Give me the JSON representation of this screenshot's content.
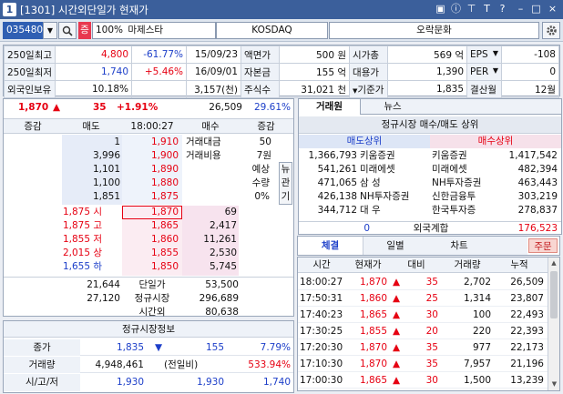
{
  "window": {
    "title": "[1301] 시간외단일가 현재가",
    "number_badge": "1",
    "controls": [
      "▣",
      "ⓘ",
      "⊤",
      "T",
      "?",
      "–",
      "□",
      "×"
    ]
  },
  "toolbar": {
    "code": "035480",
    "code_icon": "search-icon",
    "tag": "증",
    "margin": "100%",
    "name": "마제스타",
    "market": "KOSDAQ",
    "industry": "오락문화",
    "settings_icon": "gear-icon"
  },
  "info": {
    "rows": [
      [
        "250일최고",
        "4,800",
        "-61.77%",
        "15/09/23",
        "액면가",
        "500 원",
        "시가총",
        "569 억",
        "EPS",
        "-108"
      ],
      [
        "250일최저",
        "1,740",
        "+5.46%",
        "16/09/01",
        "자본금",
        "155 억",
        "대용가",
        "1,390",
        "PER",
        "0"
      ],
      [
        "외국인보유",
        "10.18%",
        "",
        "3,157(천)",
        "주식수",
        "31,021 천",
        "기준가",
        "1,835",
        "결산월",
        "12월"
      ]
    ]
  },
  "quote": {
    "price": "1,870",
    "arrow": "▲",
    "change": "35",
    "rate": "+1.91%",
    "volume": "26,509",
    "vol_rate": "29.61%"
  },
  "orderbook": {
    "headers": [
      "증감",
      "매도",
      "18:00:27",
      "매수",
      "증감"
    ],
    "asks": [
      {
        "chg": "",
        "qty": "1",
        "price": "1,910"
      },
      {
        "chg": "",
        "qty": "3,996",
        "price": "1,900"
      },
      {
        "chg": "",
        "qty": "1,101",
        "price": "1,890"
      },
      {
        "chg": "",
        "qty": "1,100",
        "price": "1,880"
      },
      {
        "chg": "",
        "qty": "1,851",
        "price": "1,875"
      }
    ],
    "ask_side_info": [
      [
        "거래대금",
        "50"
      ],
      [
        "거래비용",
        "7원"
      ]
    ],
    "expect": {
      "label1": "예상",
      "label2": "수량",
      "value": "0%",
      "tags": [
        "뉴",
        "관",
        "기"
      ]
    },
    "bids": [
      {
        "lbl": "1,875 시",
        "price": "1,870",
        "qty": "69"
      },
      {
        "lbl": "1,875 고",
        "price": "1,865",
        "qty": "2,417"
      },
      {
        "lbl": "1,855 저",
        "price": "1,860",
        "qty": "11,261"
      },
      {
        "lbl": "2,015 상",
        "price": "1,855",
        "qty": "2,530"
      },
      {
        "lbl": "1,655 하",
        "price": "1,850",
        "qty": "5,745"
      }
    ],
    "totals": [
      {
        "ask": "21,644",
        "label": "단일가",
        "bid": "53,500"
      },
      {
        "ask": "27,120",
        "label": "정규시장",
        "bid": "296,689"
      },
      {
        "ask": "",
        "label": "시간외",
        "bid": "80,638"
      }
    ]
  },
  "market_info": {
    "title": "정규시장정보",
    "rows": [
      [
        "종가",
        "1,835",
        "▼",
        "155",
        "7.79%"
      ],
      [
        "거래량",
        "4,948,461",
        "(전일비)",
        "",
        "533.94%"
      ],
      [
        "시/고/저",
        "1,930",
        "",
        "1,930",
        "1,740"
      ]
    ]
  },
  "broker": {
    "tabs": [
      "거래원",
      "뉴스"
    ],
    "title": "정규시장 매수/매도 상위",
    "sell_header": "매도상위",
    "buy_header": "매수상위",
    "rows": [
      [
        "1,366,793",
        "키움증권",
        "키움증권",
        "1,417,542"
      ],
      [
        "541,261",
        "미래에셋",
        "미래에셋",
        "482,394"
      ],
      [
        "471,065",
        "삼 성",
        "NH투자증권",
        "463,443"
      ],
      [
        "426,138",
        "NH투자증권",
        "신한금융투",
        "303,219"
      ],
      [
        "344,712",
        "대 우",
        "한국투자증",
        "278,837"
      ]
    ],
    "foreign": {
      "sell": "0",
      "label": "외국계합",
      "buy": "176,523"
    }
  },
  "ticks": {
    "tabs": [
      "체결",
      "일별",
      "차트"
    ],
    "order_button": "주문",
    "headers": [
      "시간",
      "현재가",
      "대비",
      "거래량",
      "누적"
    ],
    "rows": [
      [
        "18:00:27",
        "1,870",
        "▲",
        "35",
        "2,702",
        "26,509"
      ],
      [
        "17:50:31",
        "1,860",
        "▲",
        "25",
        "1,314",
        "23,807"
      ],
      [
        "17:40:23",
        "1,865",
        "▲",
        "30",
        "100",
        "22,493"
      ],
      [
        "17:30:25",
        "1,855",
        "▲",
        "20",
        "220",
        "22,393"
      ],
      [
        "17:20:30",
        "1,870",
        "▲",
        "35",
        "977",
        "22,173"
      ],
      [
        "17:10:30",
        "1,870",
        "▲",
        "35",
        "7,957",
        "21,196"
      ],
      [
        "17:00:30",
        "1,865",
        "▲",
        "30",
        "1,500",
        "13,239"
      ]
    ]
  }
}
